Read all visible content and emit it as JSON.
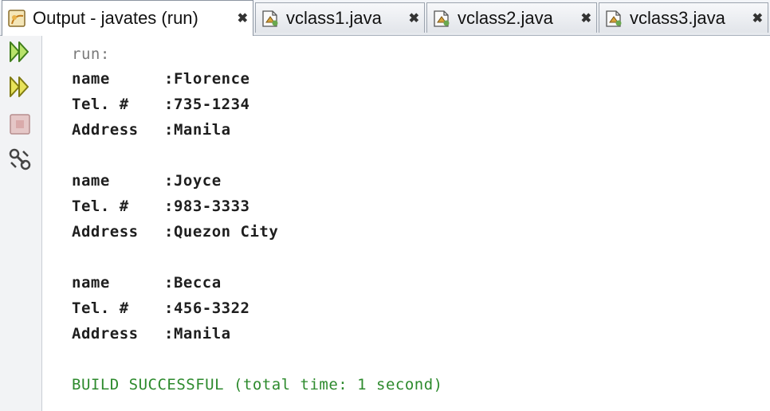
{
  "tabs": [
    {
      "label": "Output - javates (run)",
      "icon": "output-icon",
      "active": true
    },
    {
      "label": "vclass1.java",
      "icon": "java-file-icon",
      "active": false
    },
    {
      "label": "vclass2.java",
      "icon": "java-file-icon",
      "active": false
    },
    {
      "label": "vclass3.java",
      "icon": "java-file-icon",
      "active": false
    }
  ],
  "close_glyph": "✖",
  "toolbar": [
    "rerun-icon",
    "rerun-with-args-icon",
    "stop-icon",
    "settings-icon"
  ],
  "console": {
    "run_label": "run:",
    "records": [
      {
        "name_label": "name",
        "name_value": ":Florence",
        "tel_label": "Tel. #",
        "tel_value": ":735-1234",
        "address_label": "Address",
        "address_value": ":Manila"
      },
      {
        "name_label": "name",
        "name_value": ":Joyce",
        "tel_label": "Tel. #",
        "tel_value": ":983-3333",
        "address_label": "Address",
        "address_value": ":Quezon City"
      },
      {
        "name_label": "name",
        "name_value": ":Becca",
        "tel_label": "Tel. #",
        "tel_value": ":456-3322",
        "address_label": "Address",
        "address_value": ":Manila"
      }
    ],
    "build_message": "BUILD SUCCESSFUL (total time: 1 second)",
    "build_color": "#2d8a2d"
  }
}
